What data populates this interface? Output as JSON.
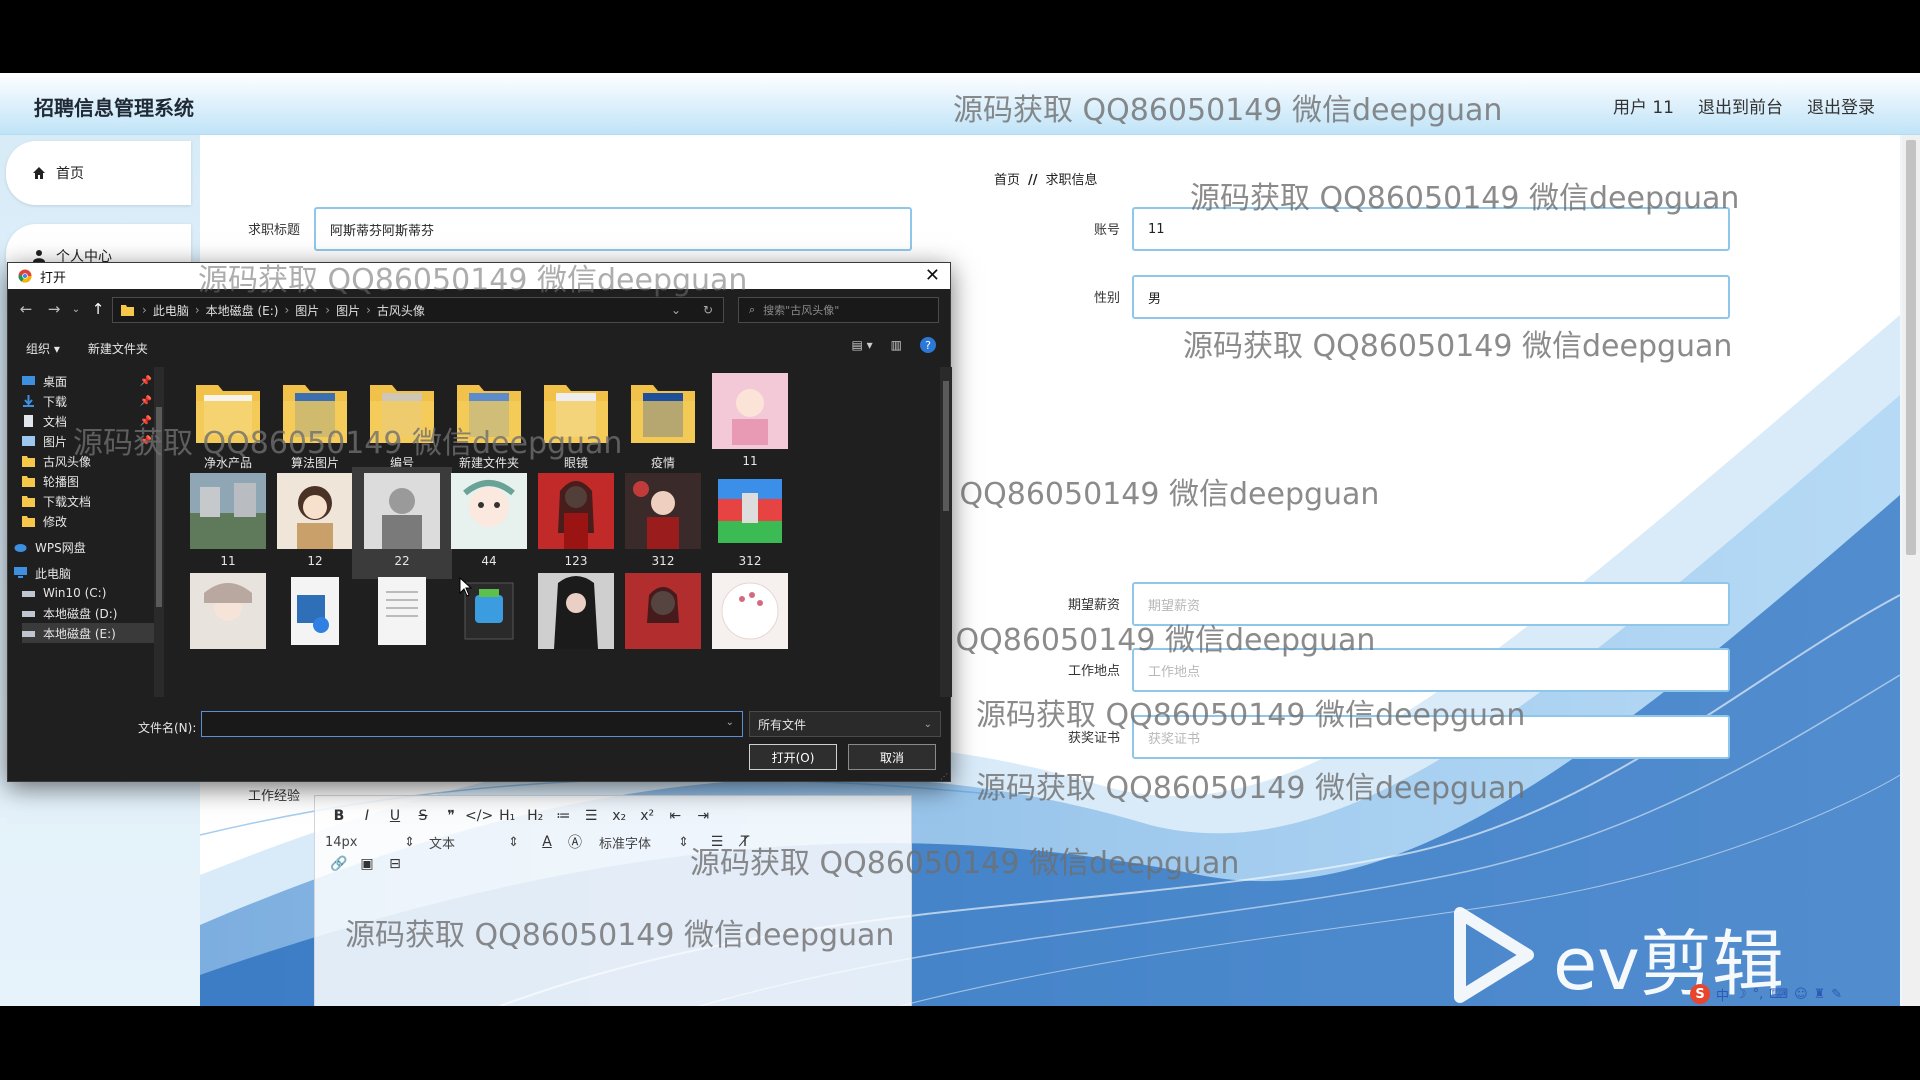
{
  "app": {
    "title": "招聘信息管理系统"
  },
  "nav": {
    "user": "用户 11",
    "to_front": "退出到前台",
    "logout": "退出登录"
  },
  "sidebar": {
    "items": [
      {
        "label": "首页"
      },
      {
        "label": "个人中心"
      }
    ]
  },
  "breadcrumb": {
    "home": "首页",
    "sep": "//",
    "current": "求职信息"
  },
  "form": {
    "title_label": "求职标题",
    "title_value": "阿斯蒂芬阿斯蒂芬",
    "account_label": "账号",
    "account_value": "11",
    "gender_label": "性别",
    "gender_value": "男",
    "salary_label": "期望薪资",
    "salary_placeholder": "期望薪资",
    "location_label": "工作地点",
    "location_placeholder": "工作地点",
    "cert_label": "获奖证书",
    "cert_placeholder": "获奖证书",
    "experience_label": "工作经验"
  },
  "editor": {
    "row1": [
      "B",
      "I",
      "U",
      "S",
      "❞",
      "</>",
      "H₁",
      "H₂",
      "≔",
      "☰",
      "x₂",
      "x²",
      "⇤",
      "⇥"
    ],
    "font_size": "14px",
    "text_type": "文本",
    "font_family": "标准字体"
  },
  "dialog": {
    "title": "打开",
    "path": [
      "此电脑",
      "本地磁盘 (E:)",
      "图片",
      "图片",
      "古风头像"
    ],
    "search_placeholder": "搜索\"古风头像\"",
    "organize": "组织 ▾",
    "new_folder": "新建文件夹",
    "nav_items": [
      {
        "label": "桌面",
        "pinned": true
      },
      {
        "label": "下载",
        "pinned": true
      },
      {
        "label": "文档",
        "pinned": true
      },
      {
        "label": "图片",
        "pinned": true
      },
      {
        "label": "古风头像",
        "pinned": false
      },
      {
        "label": "轮播图",
        "pinned": false
      },
      {
        "label": "下载文档",
        "pinned": false
      },
      {
        "label": "修改",
        "pinned": false
      },
      {
        "label": "WPS网盘",
        "pinned": false
      },
      {
        "label": "此电脑",
        "pinned": false
      },
      {
        "label": "Win10 (C:)",
        "pinned": false
      },
      {
        "label": "本地磁盘 (D:)",
        "pinned": false
      },
      {
        "label": "本地磁盘 (E:)",
        "pinned": false
      }
    ],
    "files": [
      {
        "name": "净水产品",
        "kind": "folder"
      },
      {
        "name": "算法图片",
        "kind": "folder"
      },
      {
        "name": "编号",
        "kind": "folder"
      },
      {
        "name": "新建文件夹",
        "kind": "folder"
      },
      {
        "name": "眼镜",
        "kind": "folder"
      },
      {
        "name": "疫情",
        "kind": "folder"
      },
      {
        "name": "11",
        "kind": "image"
      },
      {
        "name": "11",
        "kind": "image"
      },
      {
        "name": "12",
        "kind": "image"
      },
      {
        "name": "22",
        "kind": "image"
      },
      {
        "name": "44",
        "kind": "image"
      },
      {
        "name": "123",
        "kind": "image"
      },
      {
        "name": "312",
        "kind": "image"
      },
      {
        "name": "312",
        "kind": "archive"
      },
      {
        "name": "",
        "kind": "image"
      },
      {
        "name": "",
        "kind": "media"
      },
      {
        "name": "",
        "kind": "doc"
      },
      {
        "name": "",
        "kind": "app"
      },
      {
        "name": "",
        "kind": "image"
      },
      {
        "name": "",
        "kind": "image"
      },
      {
        "name": "",
        "kind": "image"
      }
    ],
    "filename_label": "文件名(N):",
    "filename_value": "",
    "filetype": "所有文件",
    "open_button": "打开(O)",
    "cancel_button": "取消"
  },
  "watermark": "源码获取 QQ86050149 微信deepguan",
  "colors": {
    "accent": "#8ec7ea",
    "dialog_bg": "#1f1f1f",
    "wave": "#2f86d8"
  },
  "branding": {
    "logo": "ev剪辑"
  }
}
